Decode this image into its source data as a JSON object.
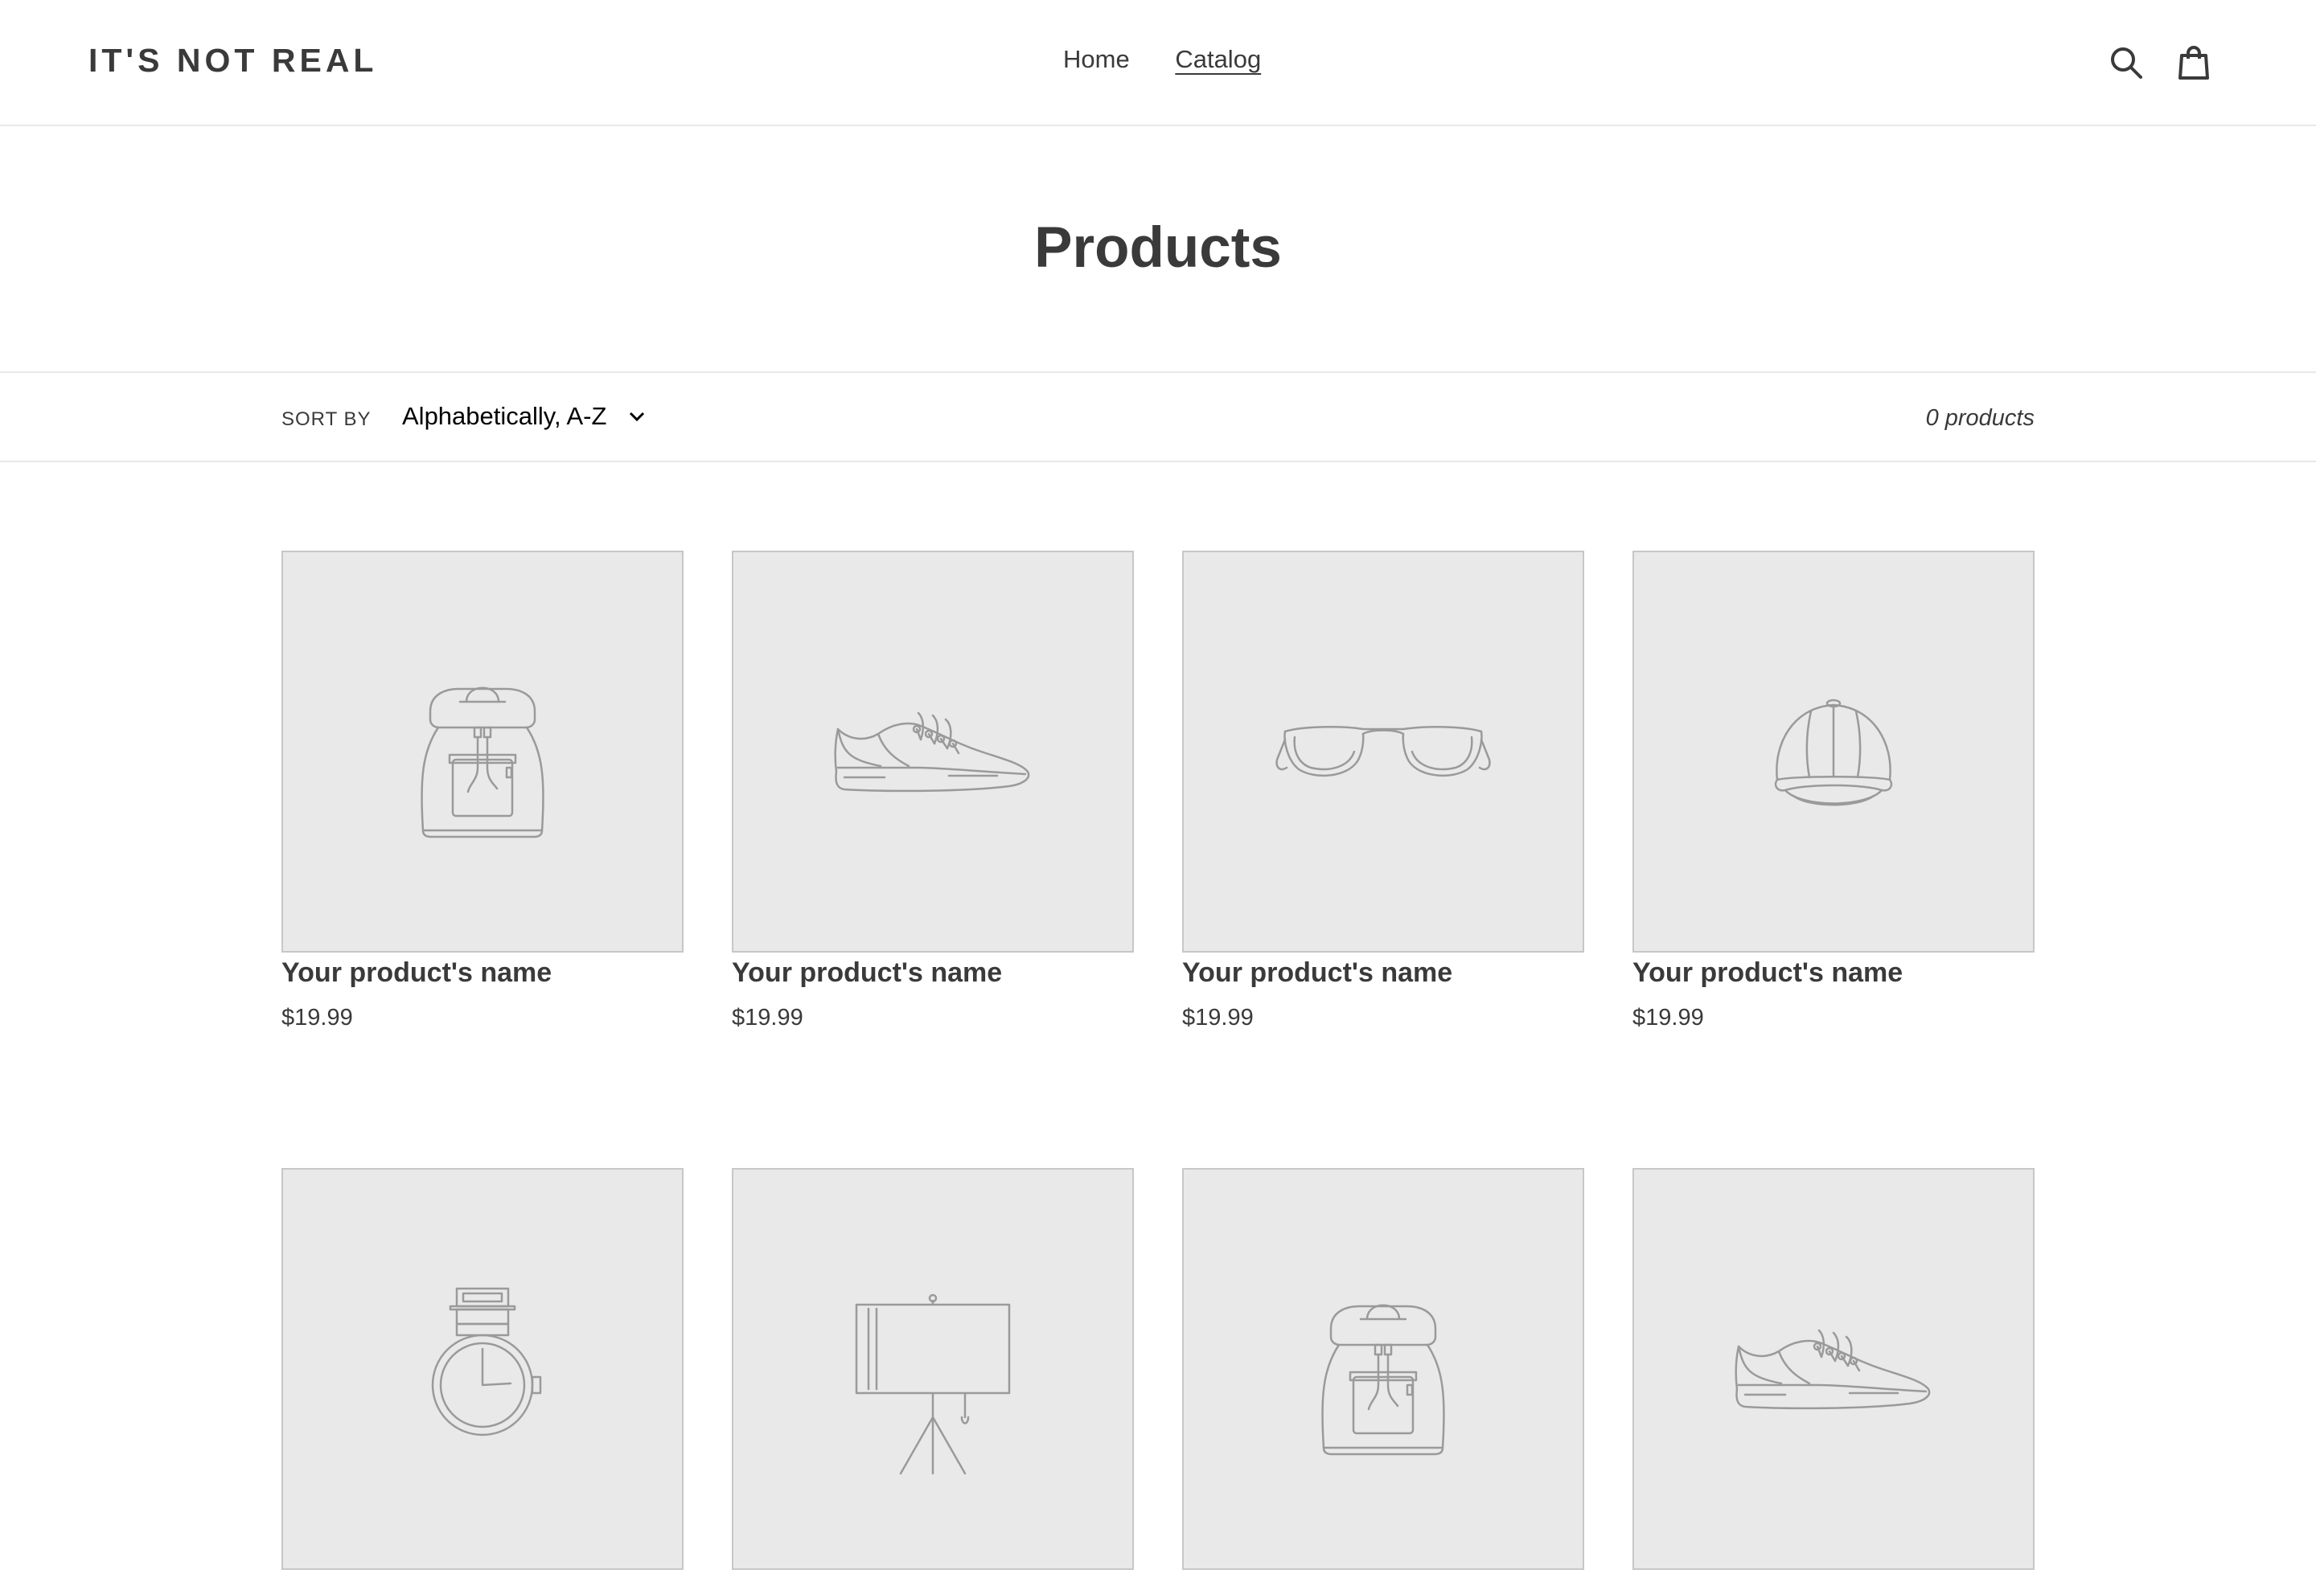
{
  "header": {
    "logo": "IT'S NOT REAL",
    "nav": [
      {
        "label": "Home",
        "active": false
      },
      {
        "label": "Catalog",
        "active": true
      }
    ],
    "icons": [
      "search-icon",
      "cart-icon"
    ]
  },
  "page": {
    "title": "Products"
  },
  "filters": {
    "sort_label": "SORT BY",
    "sort_value": "Alphabetically, A-Z",
    "count": "0 products"
  },
  "products": [
    {
      "name": "Your product's name",
      "price": "$19.99",
      "icon": "backpack-icon"
    },
    {
      "name": "Your product's name",
      "price": "$19.99",
      "icon": "sneaker-icon"
    },
    {
      "name": "Your product's name",
      "price": "$19.99",
      "icon": "sunglasses-icon"
    },
    {
      "name": "Your product's name",
      "price": "$19.99",
      "icon": "cap-icon"
    },
    {
      "name": "",
      "price": "",
      "icon": "watch-icon"
    },
    {
      "name": "",
      "price": "",
      "icon": "lamp-icon"
    },
    {
      "name": "",
      "price": "",
      "icon": "backpack-icon"
    },
    {
      "name": "",
      "price": "",
      "icon": "sneaker-icon"
    }
  ],
  "colors": {
    "text": "#3a3a3a",
    "placeholder_bg": "#e9e9e9",
    "placeholder_border": "#c7c7c7",
    "icon_stroke": "#9a9a9a"
  }
}
